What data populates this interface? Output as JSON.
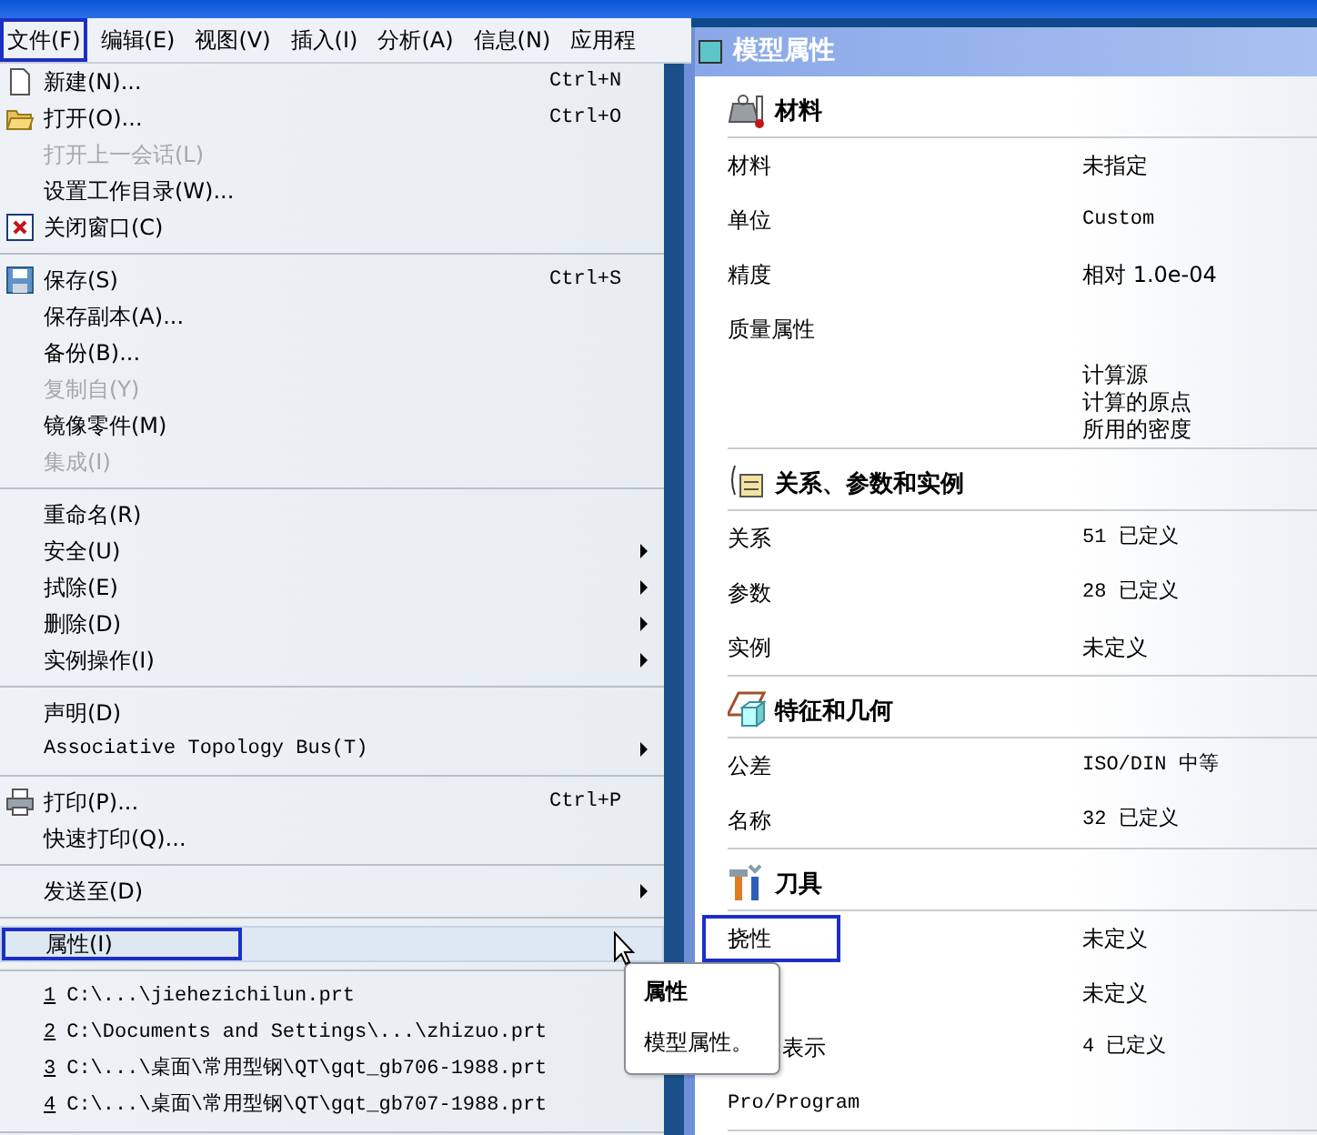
{
  "menubar": [
    {
      "label": "文件(F)",
      "annotated": true
    },
    {
      "label": "编辑(E)",
      "annotated": false
    },
    {
      "label": "视图(V)",
      "annotated": false
    },
    {
      "label": "插入(I)",
      "annotated": false
    },
    {
      "label": "分析(A)",
      "annotated": false
    },
    {
      "label": "信息(N)",
      "annotated": false
    },
    {
      "label": "应用程",
      "annotated": false
    }
  ],
  "file_menu": [
    {
      "kind": "item",
      "label": "新建(N)...",
      "shortcut": "Ctrl+N",
      "disabled": false
    },
    {
      "kind": "item",
      "label": "打开(O)...",
      "shortcut": "Ctrl+O",
      "disabled": false
    },
    {
      "kind": "item",
      "label": "打开上一会话(L)",
      "disabled": true
    },
    {
      "kind": "item",
      "label": "设置工作目录(W)...",
      "disabled": false
    },
    {
      "kind": "item",
      "label": "关闭窗口(C)",
      "disabled": false
    },
    {
      "kind": "separator"
    },
    {
      "kind": "item",
      "label": "保存(S)",
      "shortcut": "Ctrl+S",
      "disabled": false
    },
    {
      "kind": "item",
      "label": "保存副本(A)...",
      "disabled": false
    },
    {
      "kind": "item",
      "label": "备份(B)...",
      "disabled": false
    },
    {
      "kind": "item",
      "label": "复制自(Y)",
      "disabled": true
    },
    {
      "kind": "item",
      "label": "镜像零件(M)",
      "disabled": false
    },
    {
      "kind": "item",
      "label": "集成(I)",
      "disabled": true
    },
    {
      "kind": "separator"
    },
    {
      "kind": "item",
      "label": "重命名(R)",
      "disabled": false
    },
    {
      "kind": "item",
      "label": "安全(U)",
      "disabled": false,
      "submenu": true
    },
    {
      "kind": "item",
      "label": "拭除(E)",
      "disabled": false,
      "submenu": true
    },
    {
      "kind": "item",
      "label": "删除(D)",
      "disabled": false,
      "submenu": true
    },
    {
      "kind": "item",
      "label": "实例操作(I)",
      "disabled": false,
      "submenu": true
    },
    {
      "kind": "separator"
    },
    {
      "kind": "item",
      "label": "声明(D)",
      "disabled": false
    },
    {
      "kind": "item",
      "label": "Associative Topology Bus(T)",
      "disabled": false,
      "submenu": true,
      "mono": true
    },
    {
      "kind": "separator"
    },
    {
      "kind": "item",
      "label": "打印(P)...",
      "shortcut": "Ctrl+P",
      "disabled": false
    },
    {
      "kind": "item",
      "label": "快速打印(Q)...",
      "disabled": false
    },
    {
      "kind": "separator"
    },
    {
      "kind": "item",
      "label": "发送至(D)",
      "disabled": false,
      "submenu": true
    },
    {
      "kind": "separator"
    },
    {
      "kind": "item",
      "label": "属性(I)",
      "disabled": false,
      "hovered": true,
      "annotated": true
    },
    {
      "kind": "separator"
    },
    {
      "kind": "recent",
      "number": "1",
      "path": "C:\\...\\jiehezichilun.prt"
    },
    {
      "kind": "recent",
      "number": "2",
      "path": "C:\\Documents and Settings\\...\\zhizuo.prt"
    },
    {
      "kind": "recent",
      "number": "3",
      "path": "C:\\...\\桌面\\常用型钢\\QT\\gqt_gb706-1988.prt"
    },
    {
      "kind": "recent",
      "number": "4",
      "path": "C:\\...\\桌面\\常用型钢\\QT\\gqt_gb707-1988.prt"
    },
    {
      "kind": "separator"
    }
  ],
  "tooltip": {
    "title": "属性",
    "text": "模型属性。"
  },
  "panel": {
    "title": "模型属性",
    "sections": [
      {
        "heading": "材料",
        "rows": [
          {
            "label": "材料",
            "values": [
              "未指定"
            ]
          },
          {
            "label": "单位",
            "values": [
              "Custom"
            ]
          },
          {
            "label": "精度",
            "values": [
              "相对 1.0e-04"
            ]
          },
          {
            "label": "质量属性",
            "values": []
          },
          {
            "values": [
              "计算源",
              "计算的原点",
              "所用的密度"
            ]
          }
        ]
      },
      {
        "heading": "关系、参数和实例",
        "rows": [
          {
            "label": "关系",
            "values": [
              "51 已定义"
            ]
          },
          {
            "label": "参数",
            "values": [
              "28 已定义"
            ]
          },
          {
            "label": "实例",
            "values": [
              "未定义"
            ]
          }
        ]
      },
      {
        "heading": "特征和几何",
        "rows": [
          {
            "label": "公差",
            "values": [
              "ISO/DIN 中等"
            ]
          },
          {
            "label": "名称",
            "values": [
              "32 已定义"
            ]
          }
        ]
      },
      {
        "heading": "刀具",
        "rows": [
          {
            "label": "挠性",
            "values": [
              "未定义"
            ],
            "annotated": true
          },
          {
            "values": [
              "未定义"
            ]
          },
          {
            "label": "表示",
            "values": [
              "4 已定义"
            ],
            "covered": true
          },
          {
            "label": "Pro/Program",
            "values": []
          }
        ]
      }
    ]
  }
}
